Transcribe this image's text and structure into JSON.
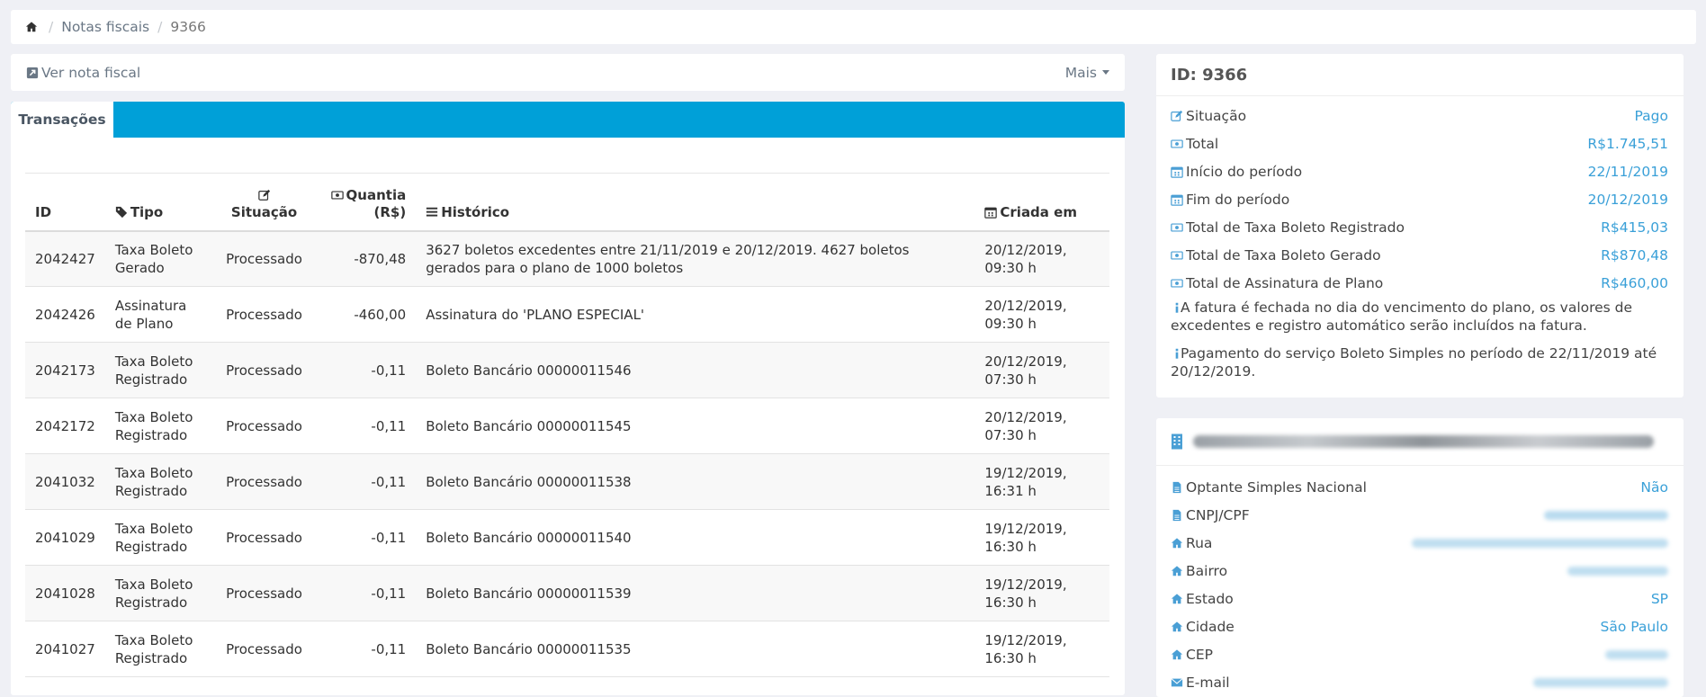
{
  "breadcrumb": {
    "home_icon": "home-icon",
    "item1": "Notas fiscais",
    "item2": "9366",
    "separator": "/"
  },
  "actions": {
    "view_label": "Ver nota fiscal",
    "more_label": "Mais"
  },
  "tabs": {
    "active": "Transações"
  },
  "table": {
    "headers": {
      "id": "ID",
      "tipo": "Tipo",
      "situacao": "Situação",
      "quantia_line1": "Quantia",
      "quantia_line2": "(R$)",
      "historico": "Histórico",
      "criada": "Criada em"
    },
    "rows": [
      {
        "id": "2042427",
        "tipo": "Taxa Boleto Gerado",
        "situacao": "Processado",
        "quantia": "-870,48",
        "historico": "3627 boletos excedentes entre 21/11/2019 e 20/12/2019. 4627 boletos gerados para o plano de 1000 boletos",
        "criada": "20/12/2019, 09:30 h"
      },
      {
        "id": "2042426",
        "tipo": "Assinatura de Plano",
        "situacao": "Processado",
        "quantia": "-460,00",
        "historico": "Assinatura do 'PLANO ESPECIAL'",
        "criada": "20/12/2019, 09:30 h"
      },
      {
        "id": "2042173",
        "tipo": "Taxa Boleto Registrado",
        "situacao": "Processado",
        "quantia": "-0,11",
        "historico": "Boleto Bancário 00000011546",
        "criada": "20/12/2019, 07:30 h"
      },
      {
        "id": "2042172",
        "tipo": "Taxa Boleto Registrado",
        "situacao": "Processado",
        "quantia": "-0,11",
        "historico": "Boleto Bancário 00000011545",
        "criada": "20/12/2019, 07:30 h"
      },
      {
        "id": "2041032",
        "tipo": "Taxa Boleto Registrado",
        "situacao": "Processado",
        "quantia": "-0,11",
        "historico": "Boleto Bancário 00000011538",
        "criada": "19/12/2019, 16:31 h"
      },
      {
        "id": "2041029",
        "tipo": "Taxa Boleto Registrado",
        "situacao": "Processado",
        "quantia": "-0,11",
        "historico": "Boleto Bancário 00000011540",
        "criada": "19/12/2019, 16:30 h"
      },
      {
        "id": "2041028",
        "tipo": "Taxa Boleto Registrado",
        "situacao": "Processado",
        "quantia": "-0,11",
        "historico": "Boleto Bancário 00000011539",
        "criada": "19/12/2019, 16:30 h"
      },
      {
        "id": "2041027",
        "tipo": "Taxa Boleto Registrado",
        "situacao": "Processado",
        "quantia": "-0,11",
        "historico": "Boleto Bancário 00000011535",
        "criada": "19/12/2019, 16:30 h"
      }
    ]
  },
  "summary": {
    "title": "ID: 9366",
    "fields": [
      {
        "label": "Situação",
        "value": "Pago",
        "icon": "edit-icon"
      },
      {
        "label": "Total",
        "value": "R$1.745,51",
        "icon": "money-icon"
      },
      {
        "label": "Início do período",
        "value": "22/11/2019",
        "icon": "calendar-icon"
      },
      {
        "label": "Fim do período",
        "value": "20/12/2019",
        "icon": "calendar-icon"
      },
      {
        "label": "Total de Taxa Boleto Registrado",
        "value": "R$415,03",
        "icon": "money-icon"
      },
      {
        "label": "Total de Taxa Boleto Gerado",
        "value": "R$870,48",
        "icon": "money-icon"
      },
      {
        "label": "Total de Assinatura de Plano",
        "value": "R$460,00",
        "icon": "money-icon"
      }
    ],
    "note1": "A fatura é fechada no dia do vencimento do plano, os valores de excedentes e registro automático serão incluídos na fatura.",
    "note2": "Pagamento do serviço Boleto Simples no período de 22/11/2019 até 20/12/2019."
  },
  "company": {
    "fields": [
      {
        "label": "Optante Simples Nacional",
        "value": "Não",
        "icon": "file-icon"
      },
      {
        "label": "CNPJ/CPF",
        "value": "",
        "icon": "file-icon"
      },
      {
        "label": "Rua",
        "value": "",
        "icon": "home-icon"
      },
      {
        "label": "Bairro",
        "value": "",
        "icon": "home-icon"
      },
      {
        "label": "Estado",
        "value": "SP",
        "icon": "home-icon"
      },
      {
        "label": "Cidade",
        "value": "São Paulo",
        "icon": "home-icon"
      },
      {
        "label": "CEP",
        "value": "",
        "icon": "home-icon"
      },
      {
        "label": "E-mail",
        "value": "",
        "icon": "envelope-icon"
      }
    ]
  },
  "colors": {
    "accent": "#00a0d8",
    "link": "#3aa0d8",
    "background": "#eff0f5"
  }
}
